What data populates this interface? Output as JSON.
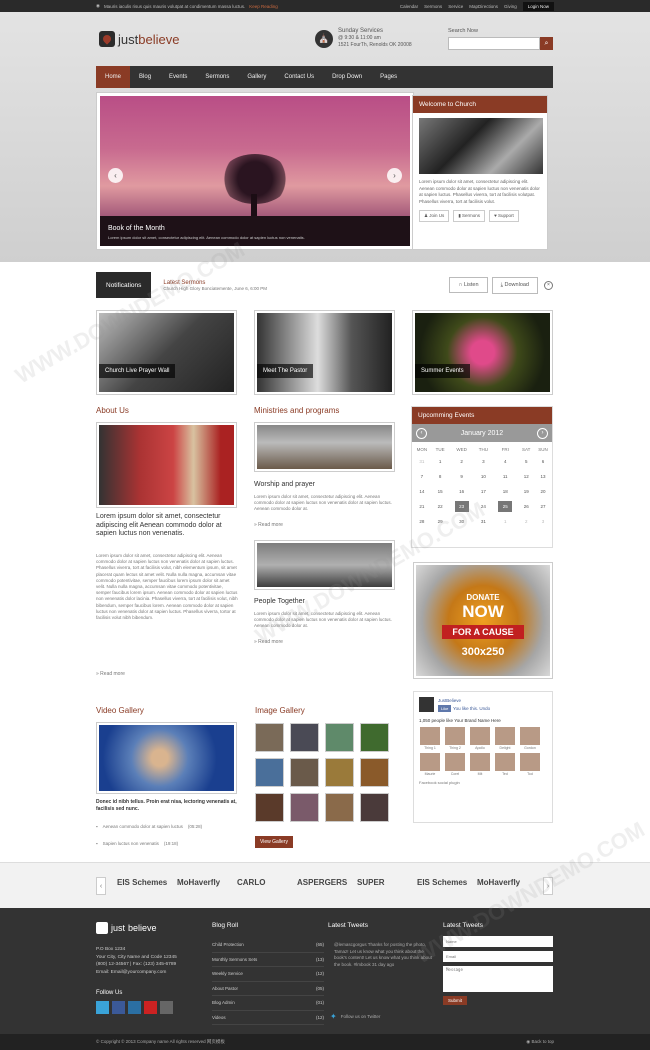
{
  "topbar": {
    "message": "Mauris iaculis risus quis mauris volutpat at condimentum massa luctus.",
    "keep_reading": "Keep Reading",
    "links": [
      "Calendar",
      "Sermons",
      "Service",
      "MapDirections",
      "Giving"
    ],
    "login": "Login Now"
  },
  "logo": {
    "part1": "just",
    "part2": "believe"
  },
  "services": {
    "title": "Sunday Services",
    "time": "@ 9:30 & 11:00 am",
    "address": "1521 FourTh, Renolds OK 20008"
  },
  "search": {
    "label": "Search Now",
    "placeholder": ""
  },
  "nav": [
    "Home",
    "Blog",
    "Events",
    "Sermons",
    "Gallery",
    "Contact Us",
    "Drop Down",
    "Pages"
  ],
  "slider": {
    "caption": "Book of the Month",
    "desc": "Lorem ipsum dolor sit amet, consectetur adipiscing elit. Aenean commodo dolor at sapien luctus non venenatis."
  },
  "welcome": {
    "title": "Welcome to Church",
    "text": "Lorem ipsum dolor sit amet, consectetur adipiscing elit. Aenean commodo dolor at sapien luctus non venenatis dolor at sapien luctus. Phasellus viverra, tort at facilisis volutpat. Phasellus viverra, tort at facilisis volut.",
    "buttons": [
      "Join Us",
      "Sermons",
      "Support"
    ]
  },
  "notification": {
    "label": "Notifications",
    "title": "Latest Sermons",
    "desc": "Church High Glory Bonciatemente, June 6, 6:00 PM",
    "listen": "Listen",
    "download": "Download"
  },
  "features": [
    "Church Live Prayer Wall",
    "Meet The Pastor",
    "Summer Events"
  ],
  "about": {
    "heading": "About Us",
    "lead": "Lorem ipsum dolor sit amet, consectetur adipiscing elit Aenean commodo dolor at sapien luctus non venenatis.",
    "body": "Lorem ipsum dolor sit amet, consectetur adipiscing elit. Aenean commodo dolor at sapien luctus non venenatis dolor at sapien luctus. Phasellus viverra, tort at facilisis volut, nibh elementum ipsum, sit amet placerat quam lectus sit amet velit. Nulla nulla magna, accumsan vitae commodo potentivitae, semper faucibus lorem ipsum dolor sit amet velit. Nulla nulla magna, accumsan vitae commodo potentivitae, semper faucibus lorem ipsum. Aenean commodo dolor at sapien luctus non venenatis dolor lacinia. Phasellus viverra, tort at facilisis volut, nibh bibendum, semper faucibus lorem. Aenean commodo dolor at sapien luctus non venenatis dolor at sapien luctus. Phasellus viverra, tortor at facilisis volut nibh bibendum.",
    "readmore": "Read more"
  },
  "ministries": {
    "heading": "Ministries and programs",
    "items": [
      {
        "title": "Worship and prayer",
        "desc": "Lorem ipsum dolor sit amet, consectetur adipiscing elit. Aenean commodo dolor at sapien luctus non venenatis dolor at sapien luctus. Aenean commodo dolor at.",
        "readmore": "Read more"
      },
      {
        "title": "People Together",
        "desc": "Lorem ipsum dolor sit amet, consectetur adipiscing elit. Aenean commodo dolor at sapien luctus non venenatis dolor at sapien luctus. Aenean commodo dolor at.",
        "readmore": "Read more"
      }
    ]
  },
  "calendar": {
    "heading": "Upcomming Events",
    "month": "January 2012",
    "days": [
      "MON",
      "TUE",
      "WED",
      "THU",
      "FRI",
      "SAT",
      "SUN"
    ],
    "weeks": [
      [
        "31",
        "1",
        "2",
        "3",
        "4",
        "5",
        "6"
      ],
      [
        "7",
        "8",
        "9",
        "10",
        "11",
        "12",
        "13"
      ],
      [
        "14",
        "15",
        "16",
        "17",
        "18",
        "19",
        "20"
      ],
      [
        "21",
        "22",
        "23",
        "24",
        "25",
        "26",
        "27"
      ],
      [
        "28",
        "29",
        "30",
        "31",
        "1",
        "2",
        "3"
      ]
    ]
  },
  "ad": {
    "line1": "DONATE",
    "line2": "NOW",
    "line3": "FOR A CAUSE",
    "line4": "300x250"
  },
  "video": {
    "heading": "Video Gallery",
    "caption": "Donec id nibh tellus. Proin erat nisa, lectoring venenatis at, facilisis sed nunc.",
    "list": [
      {
        "text": "Aenean commodo dolor at sapien luctus",
        "time": "(05:28)"
      },
      {
        "text": "Sapien luctus non venenatis",
        "time": "(19:18)"
      }
    ]
  },
  "gallery": {
    "heading": "Image Gallery",
    "button": "View Gallery"
  },
  "facebook": {
    "page": "JustBelieve",
    "like": "Like",
    "you_like": "You like this. Undo",
    "count": "1,050 people like Your Brand Name Here",
    "faces": [
      "Thing 1",
      "Thing 2",
      "Apollo",
      "Delight",
      "Gordon",
      "Maurie",
      "Corel",
      "Mit",
      "Ted",
      "Tod"
    ],
    "plugin": "Facebook social plugin"
  },
  "partners": [
    "EIS Schemes",
    "MoHaverfly",
    "CARLO",
    "ASPERGERS",
    "SUPER",
    "EIS Schemes",
    "MoHaverfly"
  ],
  "footer": {
    "addr": [
      "P.O Box 1234",
      "Your City, City Name and Code 12345",
      "(800) 12-34567 | Fax: (123) 345-6789",
      "Email: Email@yourcompany.com"
    ],
    "follow": "Follow Us",
    "blogroll_title": "Blog Roll",
    "blogroll": [
      {
        "label": "Child Protection",
        "count": "(65)"
      },
      {
        "label": "Monthly Sermons Sets",
        "count": "(13)"
      },
      {
        "label": "Weekly Service",
        "count": "(12)"
      },
      {
        "label": "About Pastor",
        "count": "(05)"
      },
      {
        "label": "Blog Admin",
        "count": "(01)"
      },
      {
        "label": "Videos",
        "count": "(12)"
      }
    ],
    "tweets_title": "Latest Tweets",
    "tweet": "@lemascgorgus Thanks for posting the photo, Tamaz! Let us know what you think about the book's content! Let us know what you think about the book. #lmbook 31 day ago",
    "follow_tw": "Follow us on Twitter",
    "form_title": "Latest Tweets",
    "form": {
      "name": "Name",
      "email": "Email",
      "message": "Message",
      "submit": "Submit"
    }
  },
  "bottom": {
    "copy": "© Copyright © 2013 Company name All rights reserved 网页模板",
    "top": "Back to top"
  },
  "watermark": "WWW.DOWNDEMO.COM"
}
